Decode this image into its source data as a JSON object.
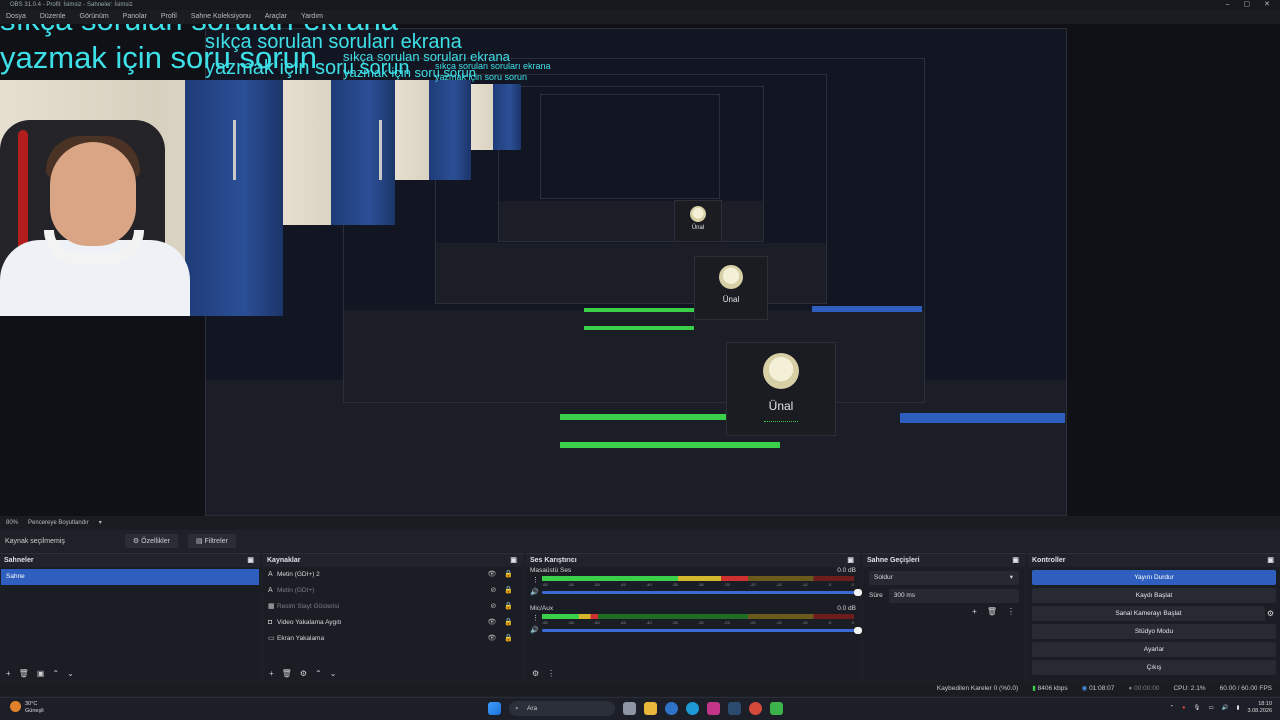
{
  "window": {
    "title": "OBS 31.0.4 - Profil: İsimsiz - Sahneler: İsimsiz",
    "menu": [
      "Dosya",
      "Düzenle",
      "Görünüm",
      "Panolar",
      "Profil",
      "Sahne Koleksiyonu",
      "Araçlar",
      "Yardım"
    ]
  },
  "preview": {
    "overlay_line1": "sıkça sorulan soruları ekrana",
    "overlay_line2": "yazmak  için soru sorun",
    "popup_name": "Ünal"
  },
  "status_row": {
    "zoom": "80%",
    "fit_label": "Pencereye Boyutlandır"
  },
  "source_bar": {
    "no_source": "Kaynak seçilmemiş",
    "properties": "Özellikler",
    "filters": "Filtreler"
  },
  "scenes": {
    "title": "Sahneler",
    "items": [
      "Sahne"
    ]
  },
  "sources": {
    "title": "Kaynaklar",
    "items": [
      {
        "label": "Metin (GDI+) 2",
        "icon": "text-icon",
        "visible": true
      },
      {
        "label": "Metin (GDI+)",
        "icon": "text-icon",
        "visible": false
      },
      {
        "label": "Resim Slayt Gösterisi",
        "icon": "slideshow-icon",
        "visible": false
      },
      {
        "label": "Video Yakalama Aygıtı",
        "icon": "camera-icon",
        "visible": true
      },
      {
        "label": "Ekran Yakalama",
        "icon": "monitor-icon",
        "visible": true
      }
    ]
  },
  "mixer": {
    "title": "Ses Karıştırıcı",
    "channels": [
      {
        "name": "Masaüstü Ses",
        "db": "0.0 dB",
        "level": 0.66
      },
      {
        "name": "Mic/Aux",
        "db": "0.0 dB",
        "level": 0.18
      }
    ],
    "ticks": [
      "-60",
      "-55",
      "-50",
      "-45",
      "-40",
      "-35",
      "-30",
      "-25",
      "-20",
      "-15",
      "-10",
      "-5",
      "0"
    ]
  },
  "transitions": {
    "title": "Sahne Geçişleri",
    "selected": "Soldur",
    "duration_label": "Süre",
    "duration_value": "300 ms"
  },
  "controls": {
    "title": "Kontroller",
    "stop_stream": "Yayını Durdur",
    "start_record": "Kaydı Başlat",
    "virtual_cam": "Sanal Kamerayı Başlat",
    "studio_mode": "Stüdyo Modu",
    "settings": "Ayarlar",
    "exit": "Çıkış"
  },
  "obs_status": {
    "dropped": "Kaybedilen Kareler 0 (%0.0)",
    "bitrate": "8406 kbps",
    "live_time": "01:08:07",
    "rec_time": "00:00:00",
    "cpu": "CPU: 2.1%",
    "fps": "60.00 / 60.00 FPS"
  },
  "taskbar": {
    "temp": "30°C",
    "weather": "Güneşli",
    "search": "Ara",
    "time": "18:10",
    "date": "3.08.2026"
  }
}
